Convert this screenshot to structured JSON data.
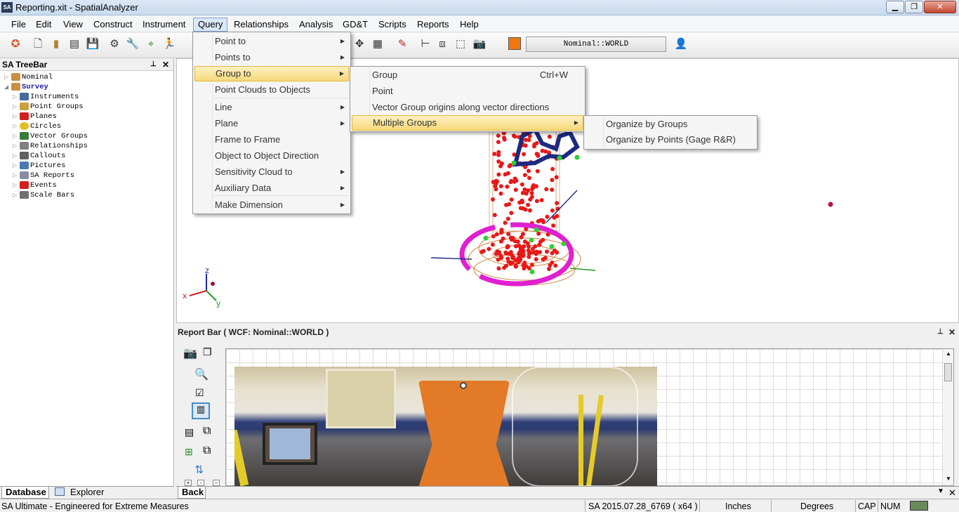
{
  "window": {
    "title": "Reporting.xit - SpatialAnalyzer",
    "logo": "SA"
  },
  "menubar": [
    "File",
    "Edit",
    "View",
    "Construct",
    "Instrument",
    "Query",
    "Relationships",
    "Analysis",
    "GD&T",
    "Scripts",
    "Reports",
    "Help"
  ],
  "toolbar": {
    "frame_label": "Nominal::WORLD",
    "color": "#f07810"
  },
  "treebar": {
    "title": "SA TreeBar",
    "items": [
      {
        "label": "Nominal",
        "level": 0,
        "bold": false
      },
      {
        "label": "Survey",
        "level": 0,
        "bold": true
      },
      {
        "label": "Instruments",
        "level": 1
      },
      {
        "label": "Point Groups",
        "level": 1
      },
      {
        "label": "Planes",
        "level": 1
      },
      {
        "label": "Circles",
        "level": 1
      },
      {
        "label": "Vector Groups",
        "level": 1
      },
      {
        "label": "Relationships",
        "level": 1
      },
      {
        "label": "Callouts",
        "level": 1
      },
      {
        "label": "Pictures",
        "level": 1
      },
      {
        "label": "SA Reports",
        "level": 1
      },
      {
        "label": "Events",
        "level": 1
      },
      {
        "label": "Scale Bars",
        "level": 1
      }
    ]
  },
  "view3d": {
    "axis_labels": {
      "x": "x",
      "y": "y",
      "z": "z"
    }
  },
  "reportbar": {
    "title": "Report Bar ( WCF: Nominal::WORLD )"
  },
  "bottom_tabs": {
    "database": "Database",
    "explorer": "Explorer",
    "back": "Back"
  },
  "statusbar": {
    "product": "SA Ultimate - Engineered for Extreme Measures",
    "version": "SA 2015.07.28_6769 ( x64 )",
    "units": "Inches",
    "angle": "Degrees",
    "cap": "CAP",
    "num": "NUM"
  },
  "query_menu": {
    "items": [
      {
        "label": "Point to",
        "submenu": true
      },
      {
        "label": "Points to",
        "submenu": true
      },
      {
        "label": "Group to",
        "submenu": true,
        "highlighted": true
      },
      {
        "label": "Point Clouds to Objects",
        "submenu": false
      },
      {
        "label": "Line",
        "submenu": true
      },
      {
        "label": "Plane",
        "submenu": true
      },
      {
        "label": "Frame to Frame",
        "submenu": false
      },
      {
        "label": "Object to Object Direction",
        "submenu": false
      },
      {
        "label": "Sensitivity Cloud to",
        "submenu": true
      },
      {
        "label": "Auxiliary Data",
        "submenu": true
      },
      {
        "label": "Make Dimension",
        "submenu": true
      }
    ]
  },
  "group_to_menu": {
    "items": [
      {
        "label": "Group",
        "shortcut": "Ctrl+W"
      },
      {
        "label": "Point",
        "shortcut": ""
      },
      {
        "label": "Vector Group origins along vector directions",
        "shortcut": ""
      },
      {
        "label": "Multiple Groups",
        "submenu": true,
        "highlighted": true
      }
    ]
  },
  "multiple_groups_menu": {
    "items": [
      {
        "label": "Organize by Groups"
      },
      {
        "label": "Organize by Points (Gage R&R)"
      }
    ]
  }
}
